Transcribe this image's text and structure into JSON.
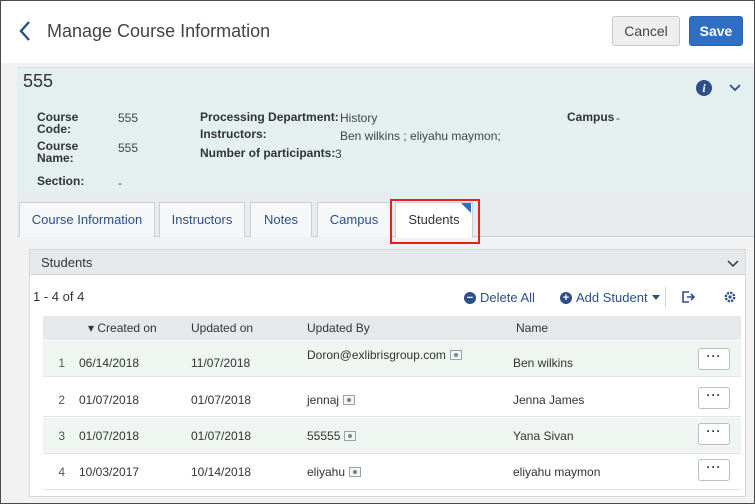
{
  "header": {
    "title": "Manage Course Information",
    "cancel_label": "Cancel",
    "save_label": "Save"
  },
  "summary": {
    "course_number": "555",
    "course_code_label": "Course Code:",
    "course_code": "555",
    "course_name_label": "Course Name:",
    "course_name": "555",
    "section_label": "Section:",
    "section": "-",
    "processing_dept_label": "Processing Department:",
    "processing_dept": "History",
    "instructors_label": "Instructors:",
    "instructors": "Ben wilkins ; eliyahu maymon;",
    "participants_label": "Number of participants:",
    "participants": "3",
    "campus_label": "Campus",
    "campus": "-"
  },
  "tabs": [
    {
      "label": "Course Information"
    },
    {
      "label": "Instructors"
    },
    {
      "label": "Notes"
    },
    {
      "label": "Campus"
    },
    {
      "label": "Students",
      "active": true
    }
  ],
  "panel": {
    "title": "Students",
    "count": "1 - 4 of 4",
    "delete_all": "Delete All",
    "add_student": "Add Student"
  },
  "table": {
    "columns": [
      "▾ Created on",
      "Updated on",
      "Updated By",
      "Name"
    ],
    "rows": [
      {
        "index": "1",
        "created": "06/14/2018",
        "updated": "11/07/2018",
        "updated_by": "Doron@exlibrisgroup.com",
        "name": "Ben wilkins"
      },
      {
        "index": "2",
        "created": "01/07/2018",
        "updated": "01/07/2018",
        "updated_by": "jennaj",
        "name": "Jenna James"
      },
      {
        "index": "3",
        "created": "01/07/2018",
        "updated": "01/07/2018",
        "updated_by": "55555",
        "name": "Yana Sivan"
      },
      {
        "index": "4",
        "created": "10/03/2017",
        "updated": "10/14/2018",
        "updated_by": "eliyahu",
        "name": "eliyahu maymon"
      }
    ],
    "row_action": "···"
  },
  "colors": {
    "accent": "#2f6fc3",
    "link": "#2c4f8a",
    "highlight": "#e0241b",
    "summary_bg": "#e4efef"
  }
}
